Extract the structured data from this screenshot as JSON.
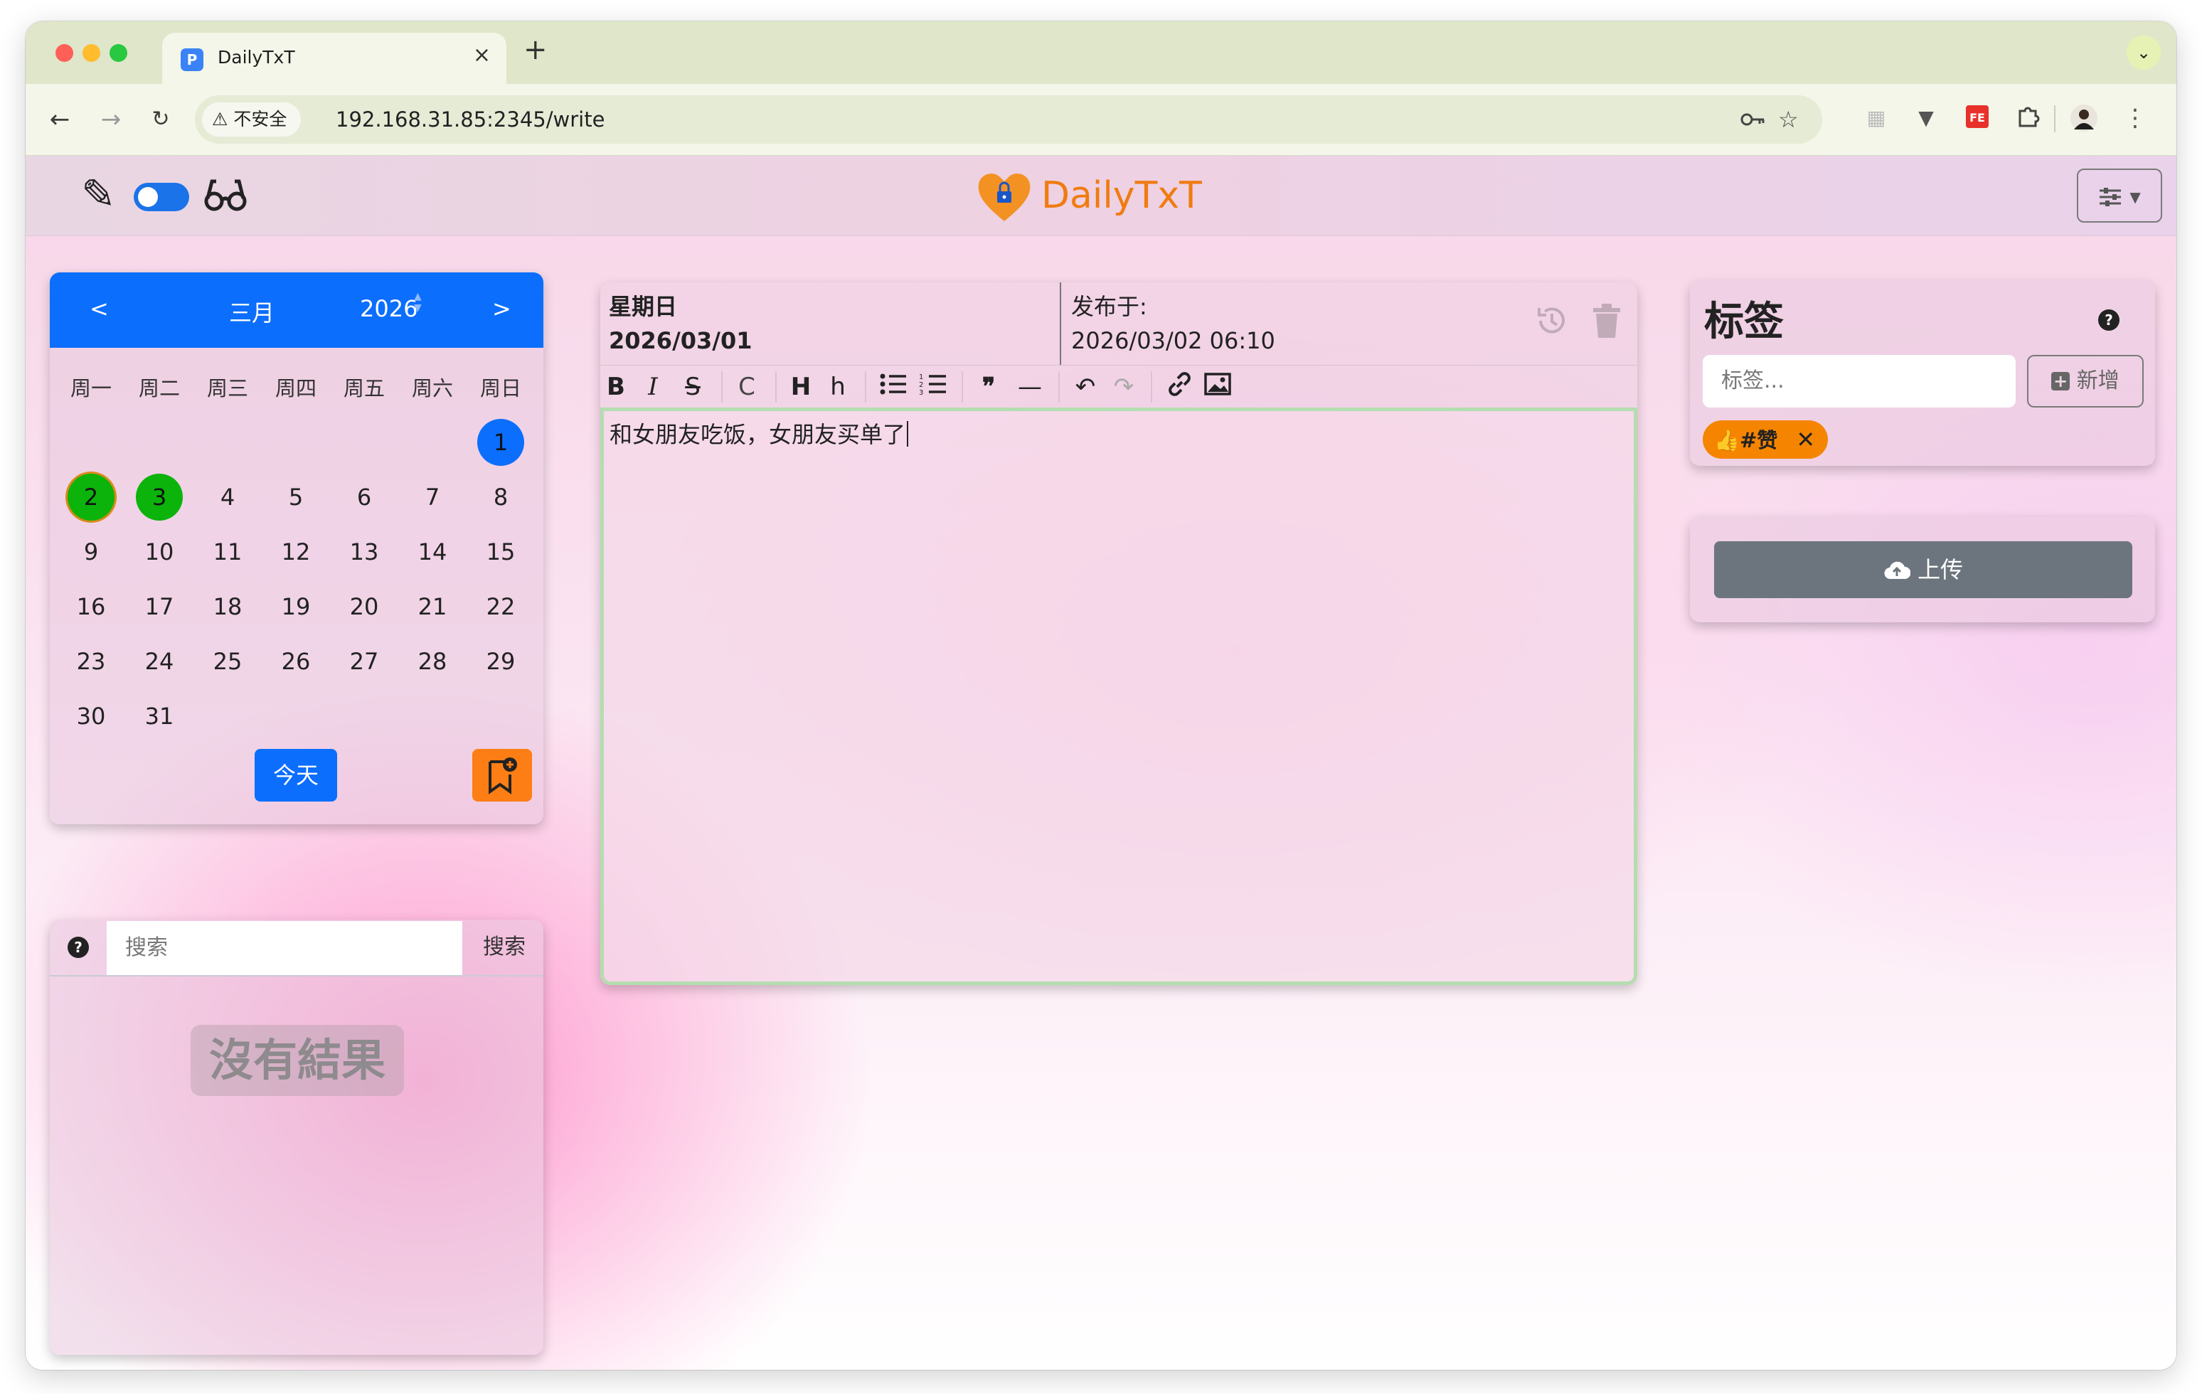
{
  "browser": {
    "tab_title": "DailyTxT",
    "favicon_letter": "P",
    "insecure_label": "不安全",
    "url": "192.168.31.85:2345/write"
  },
  "app": {
    "brand": "DailyTxT",
    "colors": {
      "accent": "#0b6efd",
      "brand": "#f07b10",
      "mark_green": "#0bb30b",
      "bookmark_orange": "#fd7e14"
    }
  },
  "calendar": {
    "prev": "<",
    "next": ">",
    "month": "三月",
    "year": "2026",
    "weekdays": [
      "周一",
      "周二",
      "周三",
      "周四",
      "周五",
      "周六",
      "周日"
    ],
    "days": [
      "1",
      "2",
      "3",
      "4",
      "5",
      "6",
      "7",
      "8",
      "9",
      "10",
      "11",
      "12",
      "13",
      "14",
      "15",
      "16",
      "17",
      "18",
      "19",
      "20",
      "21",
      "22",
      "23",
      "24",
      "25",
      "26",
      "27",
      "28",
      "29",
      "30",
      "31"
    ],
    "selected_day": "1",
    "marked_days": [
      "2",
      "3"
    ],
    "today_label": "今天"
  },
  "search": {
    "placeholder": "搜索",
    "button": "搜索",
    "empty": "沒有結果"
  },
  "editor": {
    "weekday": "星期日",
    "date": "2026/03/01",
    "published_label": "发布于:",
    "published_at": "2026/03/02 06:10",
    "content": "和女朋友吃饭，女朋友买单了",
    "toolbar": [
      "B",
      "I",
      "S",
      "C",
      "H",
      "h",
      "bullet-list",
      "ordered-list",
      "quote",
      "hr",
      "undo",
      "redo",
      "link",
      "image"
    ]
  },
  "tags": {
    "title": "标签",
    "placeholder": "标签...",
    "add_label": "新增",
    "items": [
      {
        "emoji": "👍",
        "label": "#赞"
      }
    ]
  },
  "upload": {
    "label": "上传"
  }
}
